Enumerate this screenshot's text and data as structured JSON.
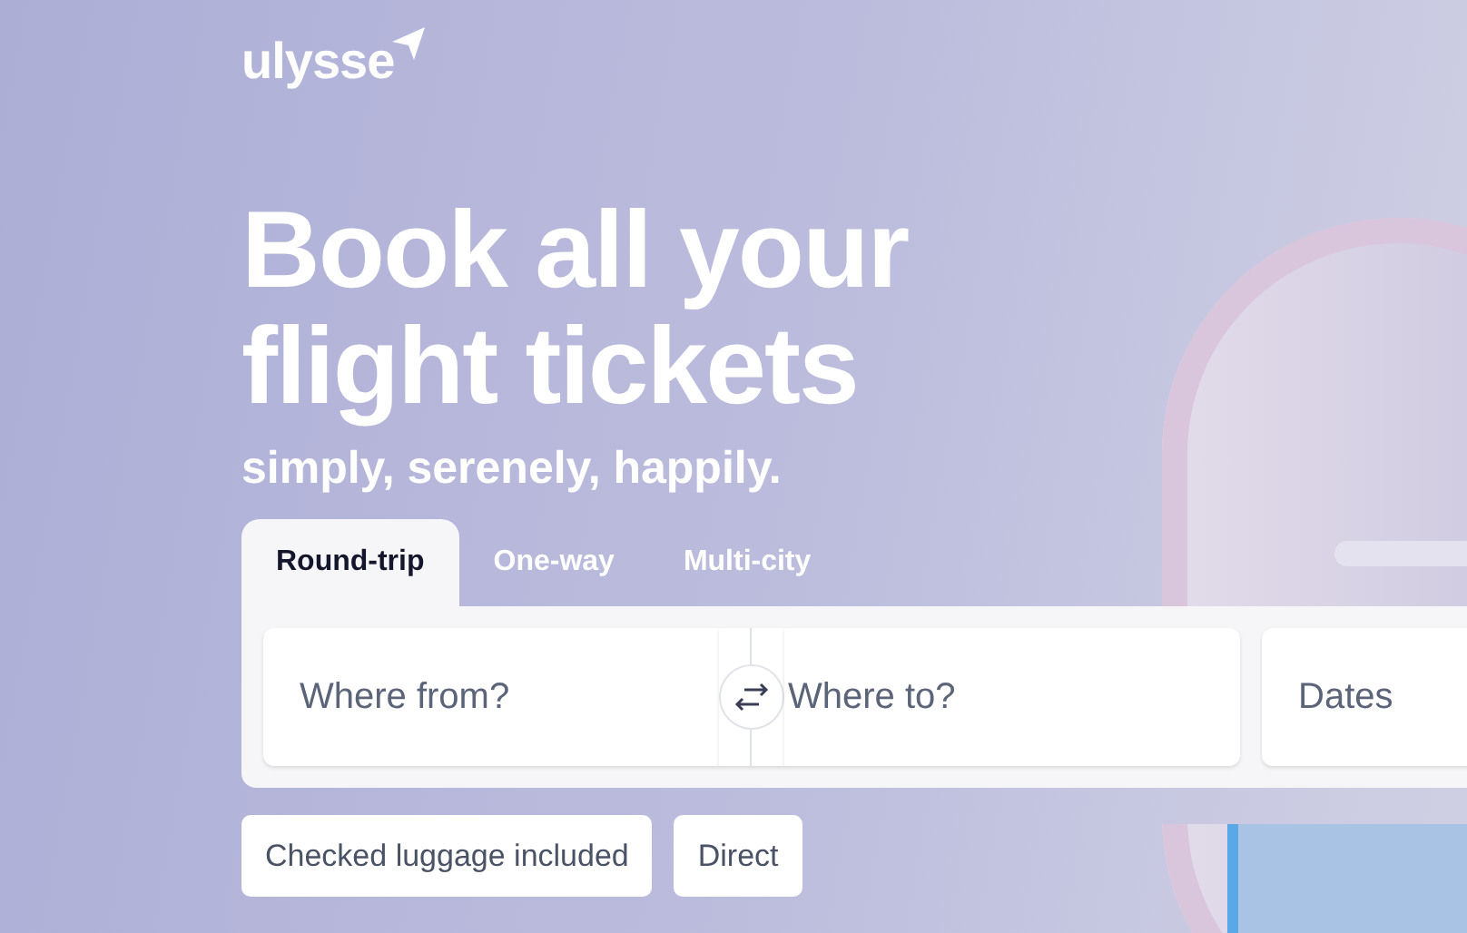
{
  "logo": {
    "text": "ulysse"
  },
  "hero": {
    "title_lines": [
      "Book all your",
      "flight tickets"
    ],
    "subtitle": "simply, serenely, happily."
  },
  "tabs": [
    {
      "label": "Round-trip",
      "selected": true
    },
    {
      "label": "One-way",
      "selected": false
    },
    {
      "label": "Multi-city",
      "selected": false
    }
  ],
  "search": {
    "from": {
      "placeholder": "Where from?"
    },
    "to": {
      "placeholder": "Where to?"
    },
    "dates": {
      "placeholder": "Dates"
    }
  },
  "filters": [
    {
      "label": "Checked luggage included"
    },
    {
      "label": "Direct"
    }
  ]
}
